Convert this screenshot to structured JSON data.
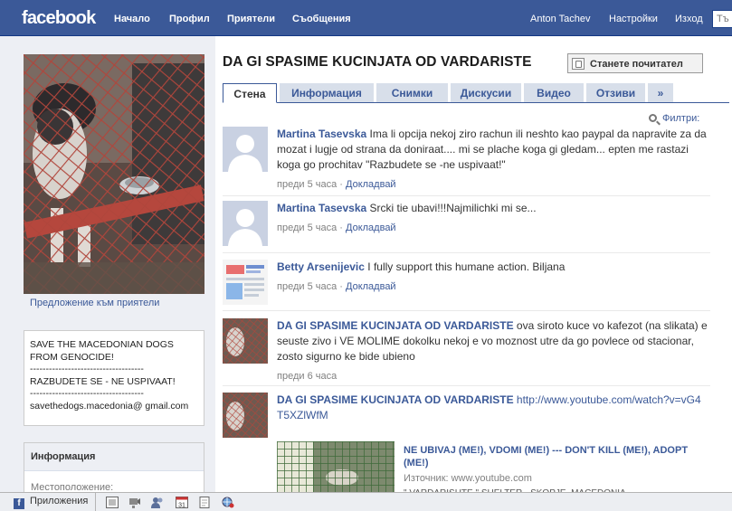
{
  "header": {
    "logo": "facebook",
    "nav": [
      "Начало",
      "Профил",
      "Приятели",
      "Съобщения"
    ],
    "user": "Anton Tachev",
    "settings": "Настройки",
    "logout": "Изход",
    "search_placeholder": "Тъ",
    "bg_color": "#3b5998"
  },
  "sidebar": {
    "suggest_link": "Предложение към приятели",
    "bio_lines": [
      "SAVE THE MACEDONIAN DOGS FROM GENOCIDE!",
      "------------------------------------",
      "RAZBUDETE SE - NE USPIVAAT!",
      "------------------------------------",
      "savethedogs.macedonia@ gmail.com"
    ],
    "info_title": "Информация",
    "info_location_label": "Местоположение:"
  },
  "page": {
    "title": "DA GI SPASIME KUCINJATA OD VARDARISTE",
    "fan_button": "Станете почитател",
    "tabs": [
      "Стена",
      "Информация",
      "Снимки",
      "Дискусии",
      "Видео",
      "Отзиви",
      "»"
    ],
    "active_tab": "Стена",
    "filter_label": "Филтри:"
  },
  "posts": [
    {
      "author": "Martina Tasevska",
      "text": "Ima li opcija nekoj ziro rachun ili neshto kao paypal da napravite za da mozat i lugje od strana da doniraat.... mi se plache koga gi gledam... epten me rastazi koga go prochitav \"Razbudete se -ne uspivaat!\"",
      "time": "преди 5 часа",
      "sep": "·",
      "action": "Докладвай"
    },
    {
      "author": "Martina Tasevska",
      "text": "Srcki tie ubavi!!!Najmilichki mi se...",
      "time": "преди 5 часа",
      "sep": "·",
      "action": "Докладвай"
    },
    {
      "author": "Betty Arsenijevic",
      "text": "I fully support this humane action. Biljana",
      "time": "преди 5 часа",
      "sep": "·",
      "action": "Докладвай"
    },
    {
      "author": "DA GI SPASIME KUCINJATA OD VARDARISTE",
      "text": "ova siroto kuce vo kafezot (na slikata) e seuste zivo i VE MOLIME dokolku nekoj e vo moznost utre da go povlece od stacionar, zosto sigurno ke bide ubieno",
      "time": "преди 6 часа"
    },
    {
      "author": "DA GI SPASIME KUCINJATA OD VARDARISTE",
      "link": "http://www.youtube.com/watch?v=vG4T5XZlWfM"
    }
  ],
  "attachment": {
    "title": "NE UBIVAJ (ME!), VDOMI (ME!) --- DON'T KILL (ME!), ADOPT (ME!)",
    "source": "Източник: www.youtube.com",
    "desc": "\" VARDARISHTE \" SHELTER - SKOPJE, MACEDONIA"
  },
  "bottombar": {
    "apps_label": "Приложения",
    "icons": [
      "applications-icon",
      "chat-video-icon",
      "friends-icon",
      "calendar-icon",
      "notes-icon",
      "network-globe-icon"
    ],
    "calendar_day": "31"
  }
}
